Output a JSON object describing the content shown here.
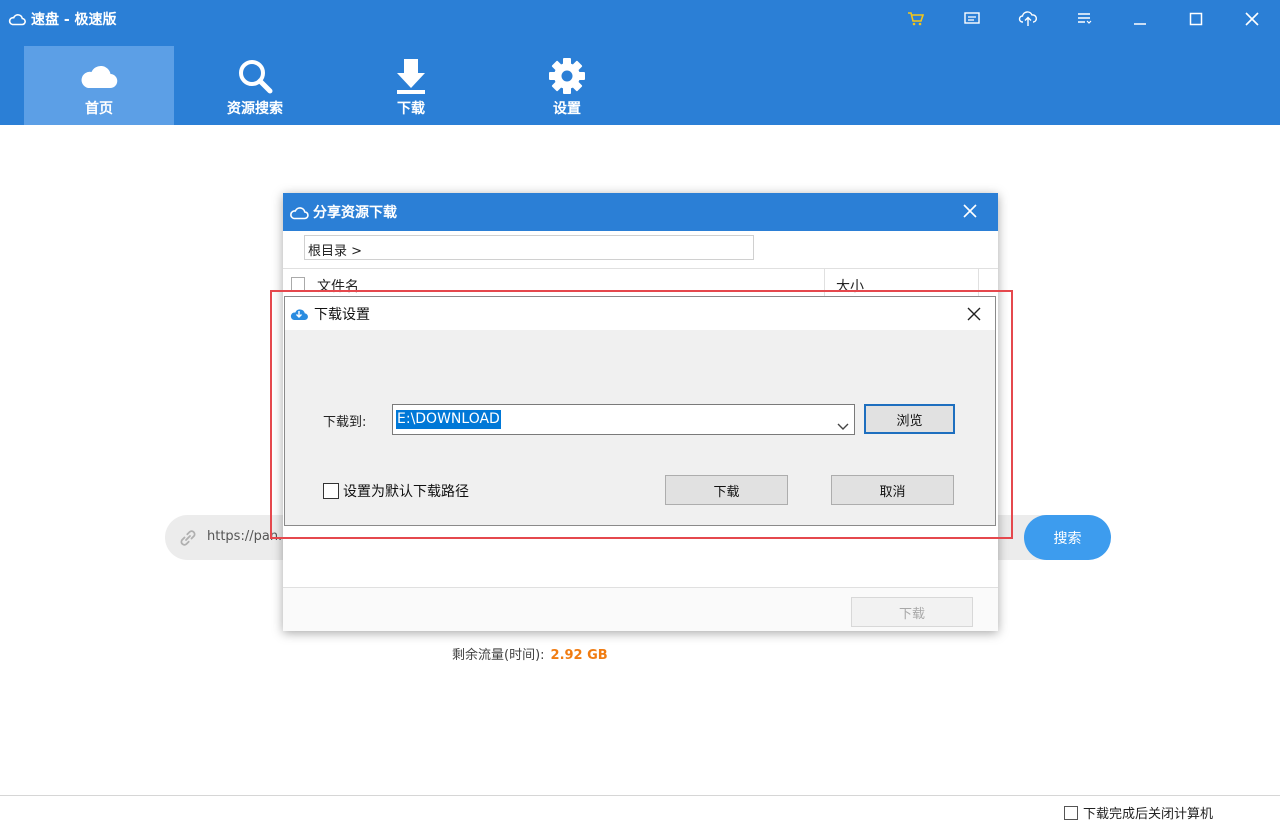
{
  "app": {
    "title": "速盘 - 极速版",
    "accent_color": "#2b7fd6",
    "window_buttons": [
      "cart-icon",
      "message-icon",
      "upload-cloud-icon",
      "menu-icon",
      "minimize-icon",
      "maximize-icon",
      "close-icon"
    ]
  },
  "nav": {
    "tabs": [
      {
        "label": "首页",
        "icon": "cloud-icon",
        "active": true
      },
      {
        "label": "资源搜索",
        "icon": "search-icon",
        "active": false
      },
      {
        "label": "下载",
        "icon": "download-icon",
        "active": false
      },
      {
        "label": "设置",
        "icon": "gear-icon",
        "active": false
      }
    ]
  },
  "main": {
    "url_value": "https://pan...",
    "search_label": "搜索",
    "quota_label": "剩余流量(时间):",
    "quota_value": "2.92 GB",
    "quota_color": "#f07c12"
  },
  "footer": {
    "auto_shutdown_label": "下载完成后关闭计算机",
    "auto_shutdown_checked": false
  },
  "share_dialog": {
    "title": "分享资源下载",
    "breadcrumb": "根目录 >",
    "columns": [
      "文件名",
      "大小"
    ],
    "download_label": "下载"
  },
  "download_settings": {
    "title": "下载设置",
    "path_label": "下载到:",
    "path_value": "E:\\DOWNLOAD",
    "browse_label": "浏览",
    "set_default_label": "设置为默认下载路径",
    "set_default_checked": false,
    "download_label": "下载",
    "cancel_label": "取消"
  }
}
